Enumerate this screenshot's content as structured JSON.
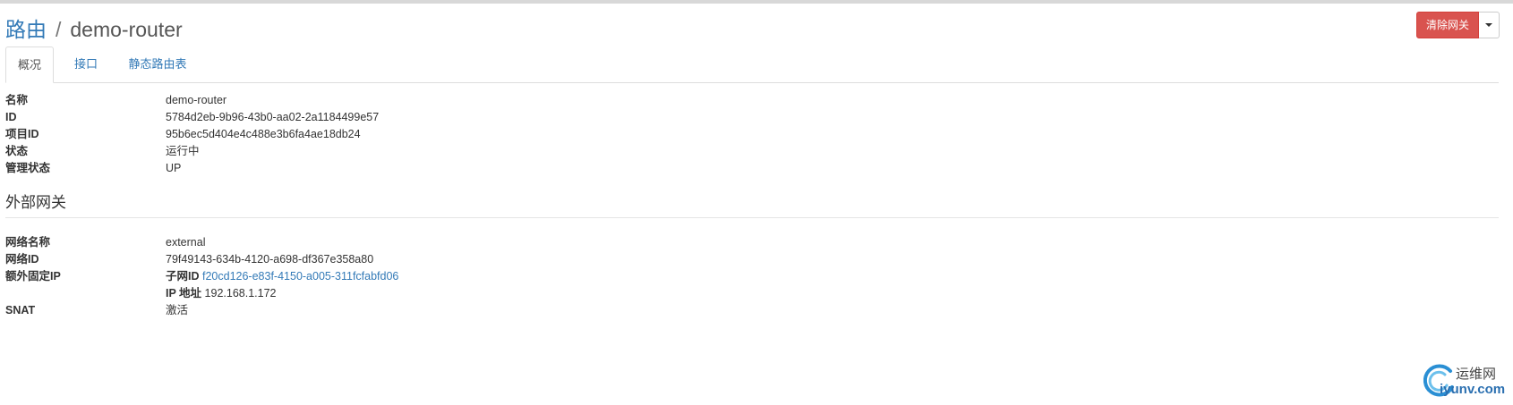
{
  "header": {
    "breadcrumb_root": "路由",
    "separator": "/",
    "title": "demo-router",
    "clear_gateway_label": "清除网关"
  },
  "tabs": [
    {
      "label": "概况",
      "active": true
    },
    {
      "label": "接口",
      "active": false
    },
    {
      "label": "静态路由表",
      "active": false
    }
  ],
  "overview": [
    {
      "key": "名称",
      "value": "demo-router"
    },
    {
      "key": "ID",
      "value": "5784d2eb-9b96-43b0-aa02-2a1184499e57"
    },
    {
      "key": "项目ID",
      "value": "95b6ec5d404e4c488e3b6fa4ae18db24"
    },
    {
      "key": "状态",
      "value": "运行中"
    },
    {
      "key": "管理状态",
      "value": "UP"
    }
  ],
  "external_gateway": {
    "heading": "外部网关",
    "network_name_label": "网络名称",
    "network_name": "external",
    "network_id_label": "网络ID",
    "network_id": "79f49143-634b-4120-a698-df367e358a80",
    "fixed_ip_label": "额外固定IP",
    "subnet_id_label": "子网ID",
    "subnet_id": "f20cd126-e83f-4150-a005-311fcfabfd06",
    "ip_address_label": "IP 地址",
    "ip_address": "192.168.1.172",
    "snat_label": "SNAT",
    "snat": "激活"
  },
  "watermark": {
    "cn": "运维网",
    "en": "iyunv.com"
  },
  "colors": {
    "accent": "#337ab7",
    "danger": "#d9534f"
  }
}
